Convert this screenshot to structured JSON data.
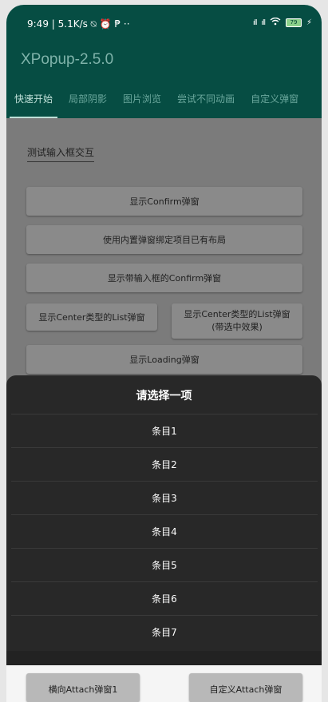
{
  "status_bar": {
    "left_text": "9:49 | 5.1K/s ⍉ ⏰ ₱ ··",
    "signal1": "ıll",
    "signal2": "ıll",
    "wifi": "WiFi",
    "battery": "79",
    "charging": "⚡"
  },
  "app": {
    "title": "XPopup-2.5.0"
  },
  "tabs": [
    "快速开始",
    "局部阴影",
    "图片浏览",
    "尝试不同动画",
    "自定义弹窗"
  ],
  "content": {
    "input_label": "测试输入框交互",
    "buttons": {
      "confirm": "显示Confirm弹窗",
      "bind_layout": "使用内置弹窗绑定项目已有布局",
      "input_confirm": "显示带输入框的Confirm弹窗",
      "center_list": "显示Center类型的List弹窗",
      "center_list_checked_line1": "显示Center类型的List弹窗",
      "center_list_checked_line2": "(带选中效果)",
      "loading": "显示Loading弹窗",
      "attach_horizontal": "横向Attach弹窗1",
      "custom_attach": "自定义Attach弹窗"
    }
  },
  "sheet": {
    "title": "请选择一项",
    "items": [
      "条目1",
      "条目2",
      "条目3",
      "条目4",
      "条目5",
      "条目6",
      "条目7"
    ]
  }
}
